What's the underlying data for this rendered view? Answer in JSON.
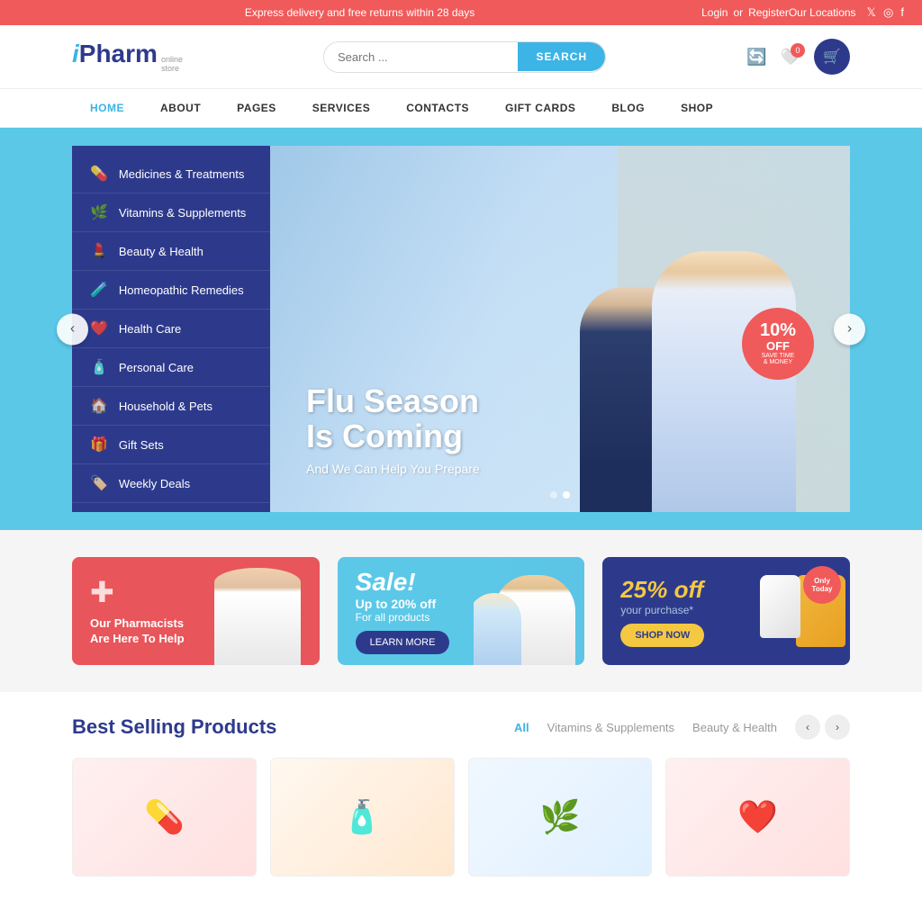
{
  "topBar": {
    "announcement": "Express delivery and free returns within 28 days",
    "login": "Login",
    "or": "or",
    "register": "Register",
    "locations": "Our Locations",
    "socials": [
      "twitter",
      "instagram",
      "facebook"
    ]
  },
  "header": {
    "logo": {
      "i": "i",
      "pharm": "Pharm",
      "sub1": "online",
      "sub2": "store"
    },
    "search": {
      "placeholder": "Search ...",
      "button": "SEARCH"
    },
    "cartCount": "0"
  },
  "nav": {
    "items": [
      {
        "label": "HOME",
        "active": true
      },
      {
        "label": "ABOUT",
        "active": false
      },
      {
        "label": "PAGES",
        "active": false
      },
      {
        "label": "SERVICES",
        "active": false
      },
      {
        "label": "CONTACTS",
        "active": false
      },
      {
        "label": "GIFT CARDS",
        "active": false
      },
      {
        "label": "BLOG",
        "active": false
      },
      {
        "label": "SHOP",
        "active": false
      }
    ]
  },
  "sidebar": {
    "items": [
      {
        "label": "Medicines & Treatments",
        "icon": "💊"
      },
      {
        "label": "Vitamins & Supplements",
        "icon": "🌿"
      },
      {
        "label": "Beauty & Health",
        "icon": "💄"
      },
      {
        "label": "Homeopathic Remedies",
        "icon": "🧪"
      },
      {
        "label": "Health Care",
        "icon": "❤️"
      },
      {
        "label": "Personal Care",
        "icon": "🧴"
      },
      {
        "label": "Household & Pets",
        "icon": "🏠"
      },
      {
        "label": "Gift Sets",
        "icon": "🎁"
      },
      {
        "label": "Weekly Deals",
        "icon": "🏷️"
      }
    ]
  },
  "hero": {
    "title": "Flu Season\nIs Coming",
    "subtitle": "And We Can Help You Prepare",
    "discount": {
      "pct": "10%",
      "off": "OFF",
      "save": "SAVE TIME",
      "money": "& MONEY"
    },
    "prevLabel": "‹",
    "nextLabel": "›",
    "dots": [
      1,
      2
    ]
  },
  "promoCards": [
    {
      "id": "pharmacist",
      "icon": "✚",
      "title": "Our Pharmacists\nAre Here To Help"
    },
    {
      "id": "sale",
      "saleText": "Sale!",
      "upTo": "Up to 20% off",
      "forAll": "For all products",
      "btnLabel": "LEARN MORE"
    },
    {
      "id": "discount",
      "offText": "25% off",
      "purchaseText": "your purchase*",
      "btnLabel": "SHOP NOW",
      "badgeLine1": "Only",
      "badgeLine2": "Today"
    }
  ],
  "bestSelling": {
    "title": "Best Selling Products",
    "filters": [
      "All",
      "Vitamins & Supplements",
      "Beauty & Health"
    ],
    "prevArrow": "‹",
    "nextArrow": "›"
  }
}
